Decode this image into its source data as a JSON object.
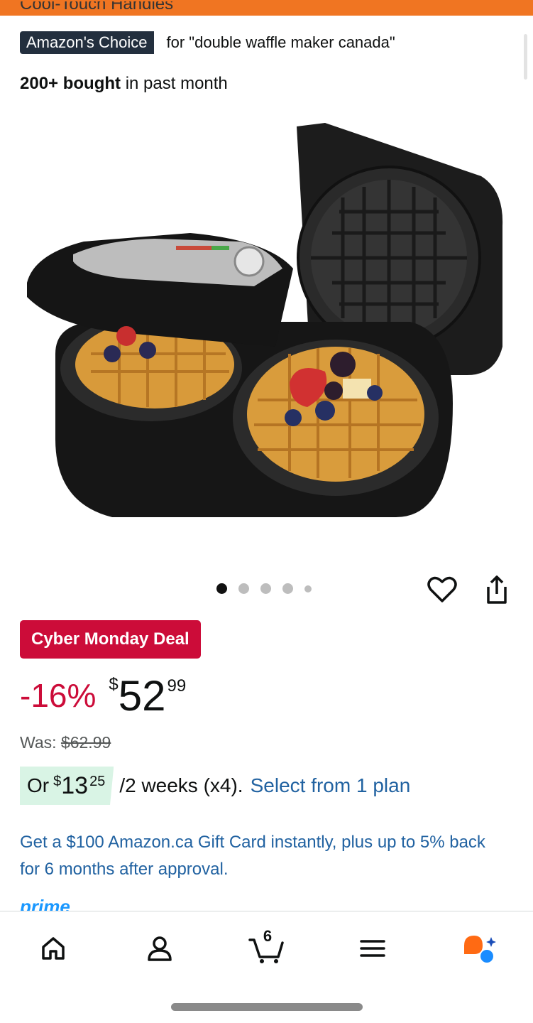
{
  "header": {
    "partial_text": "Cool-Touch Handles"
  },
  "badge": {
    "label": "Amazon's Choice",
    "for_text": "for \"double waffle maker canada\""
  },
  "social_proof": {
    "count": "200+ bought",
    "suffix": " in past month"
  },
  "gallery": {
    "image_alt": "double waffle maker",
    "total_dots": 5,
    "active_index": 0
  },
  "deal": {
    "label": "Cyber Monday Deal"
  },
  "price": {
    "discount": "-16%",
    "currency": "$",
    "whole": "52",
    "fraction": "99",
    "was_label": "Was: ",
    "was_value": "$62.99"
  },
  "installment": {
    "prefix": "Or",
    "currency": "$",
    "whole": "13",
    "fraction": "25",
    "period": "/2 weeks (x4).",
    "link": "Select from 1 plan"
  },
  "promo": {
    "text": "Get a $100 Amazon.ca Gift Card instantly, plus up to 5% back for 6 months after approval."
  },
  "prime": {
    "label": "prime"
  },
  "nav": {
    "items": [
      {
        "name": "home",
        "icon": "home-icon"
      },
      {
        "name": "account",
        "icon": "person-icon"
      },
      {
        "name": "cart",
        "icon": "cart-icon",
        "count": "6"
      },
      {
        "name": "menu",
        "icon": "hamburger-icon"
      },
      {
        "name": "rufus",
        "icon": "ai-assistant-icon"
      }
    ]
  },
  "colors": {
    "accent": "#f07522",
    "deal": "#cc0c39",
    "link": "#2162a1",
    "highlight": "#d9f4e5",
    "badge": "#232f3e"
  }
}
